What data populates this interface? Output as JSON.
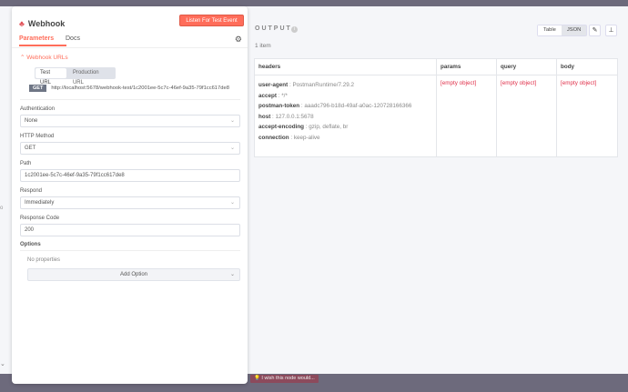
{
  "node": {
    "title": "Webhook",
    "listen_label": "Listen For Test Event"
  },
  "tabs": {
    "parameters": "Parameters",
    "docs": "Docs"
  },
  "webhook_urls": {
    "label": "Webhook URLs",
    "test_url": "Test URL",
    "production_url": "Production URL",
    "method": "GET",
    "url": "http://localhost:5678/webhook-test/1c2001ee-5c7c-46ef-9a35-79f1cc617de8"
  },
  "fields": {
    "authentication": {
      "label": "Authentication",
      "value": "None"
    },
    "http_method": {
      "label": "HTTP Method",
      "value": "GET"
    },
    "path": {
      "label": "Path",
      "value": "1c2001ee-5c7c-46ef-9a35-79f1cc617de8"
    },
    "respond": {
      "label": "Respond",
      "value": "Immediately"
    },
    "response_code": {
      "label": "Response Code",
      "value": "200"
    }
  },
  "options": {
    "label": "Options",
    "empty": "No properties",
    "add": "Add Option"
  },
  "output": {
    "title": "OUTPUT",
    "count": "1 item",
    "view_table": "Table",
    "view_json": "JSON",
    "columns": [
      "headers",
      "params",
      "query",
      "body"
    ],
    "headers": [
      {
        "k": "user-agent",
        "v": "PostmanRuntime/7.29.2"
      },
      {
        "k": "accept",
        "v": "*/*"
      },
      {
        "k": "postman-token",
        "v": "aaadc796-b18d-49af-a0ac-120728166366"
      },
      {
        "k": "host",
        "v": "127.0.0.1:5678"
      },
      {
        "k": "accept-encoding",
        "v": "gzip, deflate, br"
      },
      {
        "k": "connection",
        "v": "keep-alive"
      }
    ],
    "empty": "[empty object]"
  },
  "feedback": "I wish this node would..."
}
